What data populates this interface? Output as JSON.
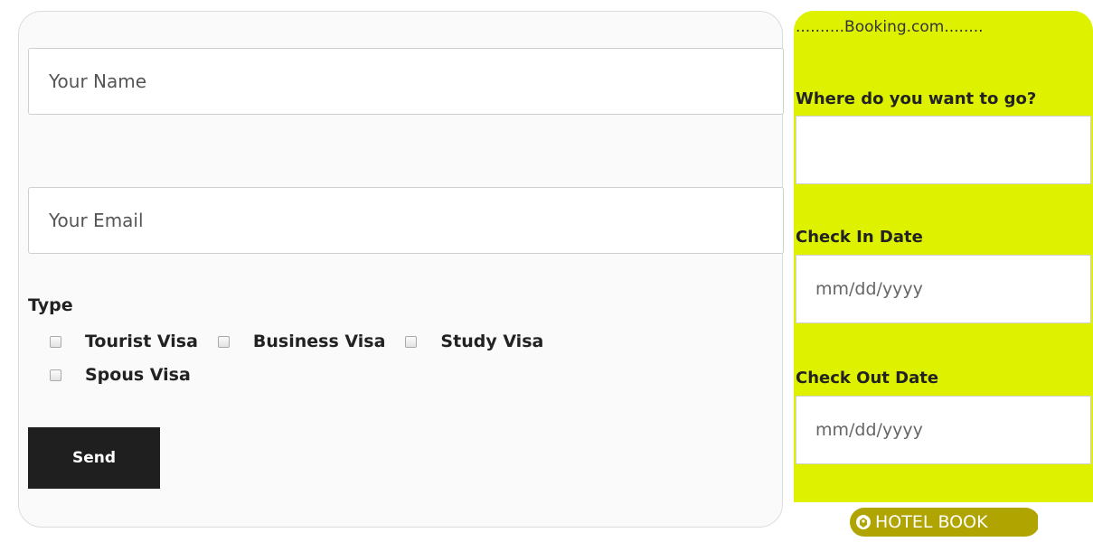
{
  "contact_form": {
    "name_placeholder": "Your Name",
    "email_placeholder": "Your Email",
    "type_label": "Type",
    "visa_types": [
      {
        "label": "Tourist Visa",
        "checked": false
      },
      {
        "label": "Business Visa",
        "checked": false
      },
      {
        "label": "Study Visa",
        "checked": false
      },
      {
        "label": "Spous Visa",
        "checked": false
      }
    ],
    "send_label": "Send"
  },
  "booking": {
    "title": "..........Booking.com........",
    "background_color": "#def200",
    "where_label": "Where do you want to go?",
    "checkin_label": "Check In Date",
    "checkin_placeholder": "mm/dd/yyyy",
    "checkout_label": "Check Out Date",
    "checkout_placeholder": "mm/dd/yyyy",
    "hotel_book_label": "HOTEL BOOK",
    "hotel_book_icon": "tag-icon",
    "hotel_book_color": "#b0a400"
  }
}
